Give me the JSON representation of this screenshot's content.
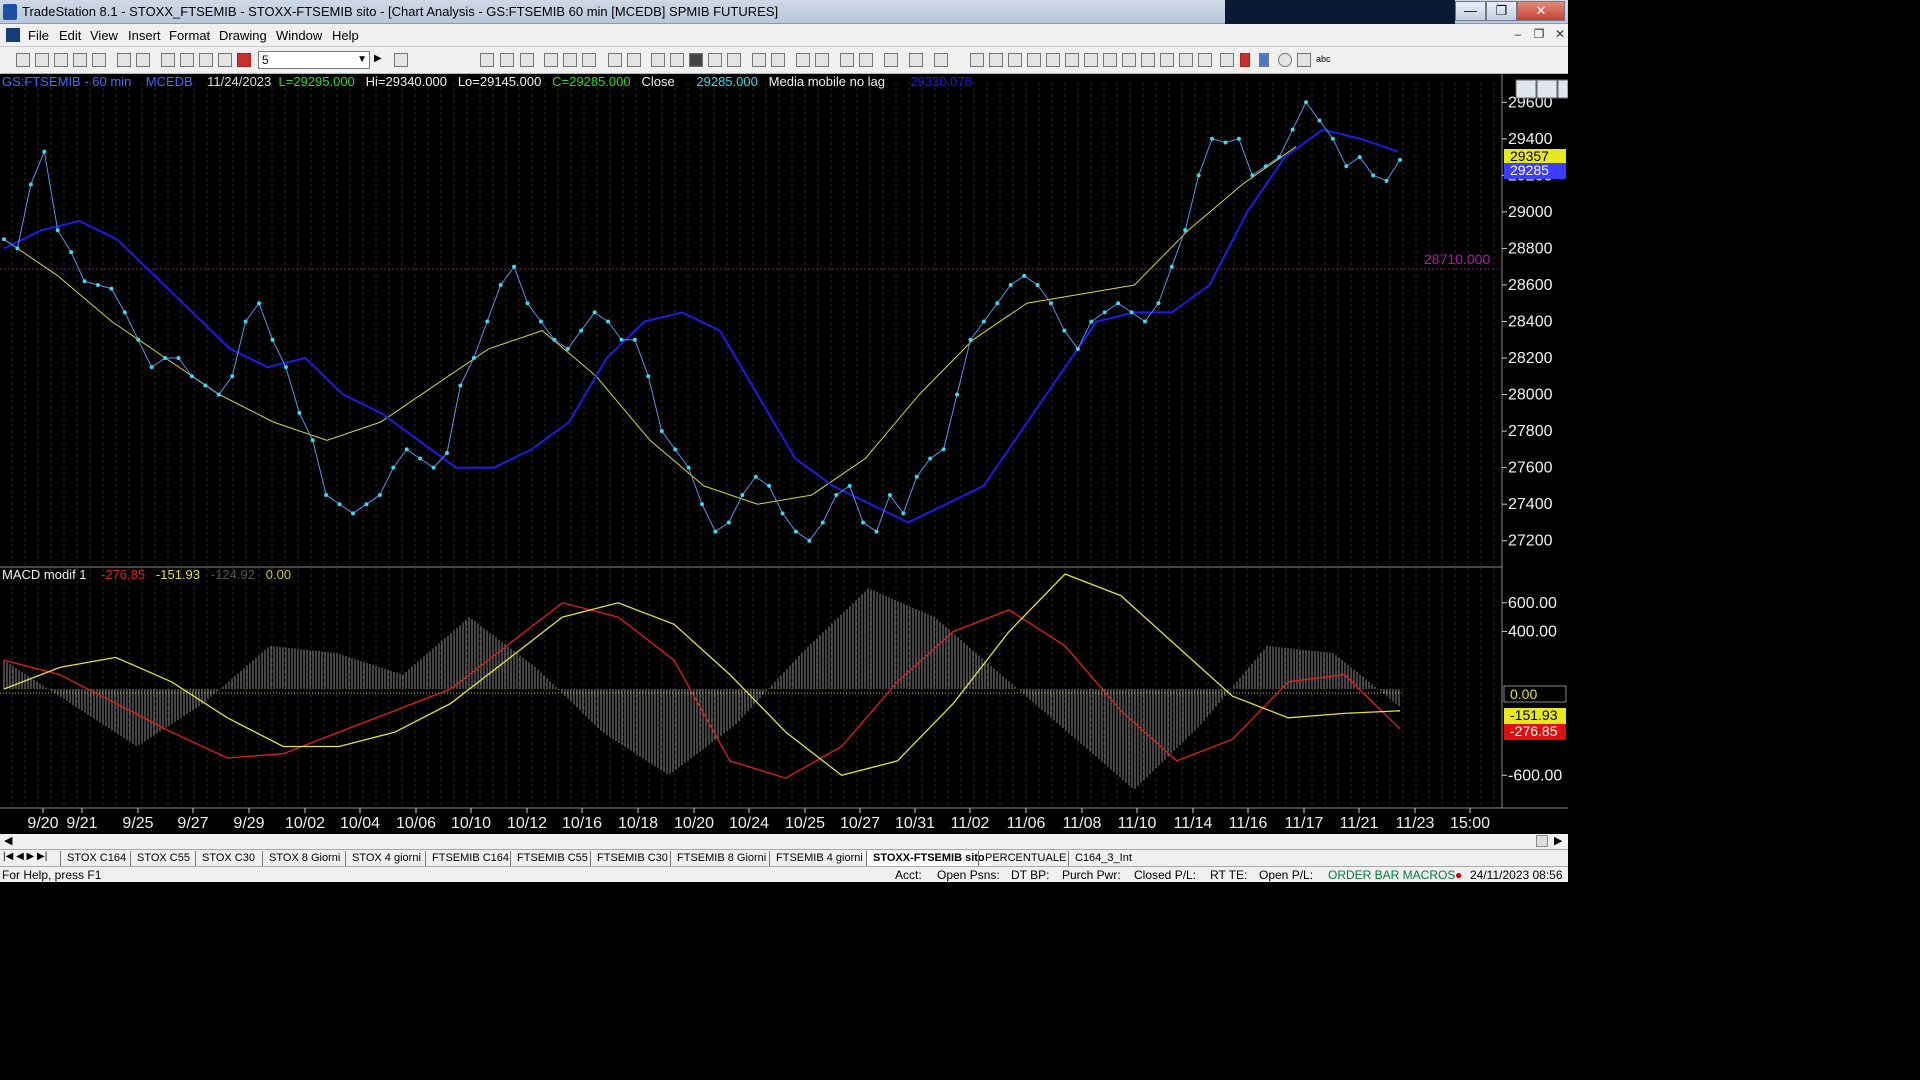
{
  "window": {
    "title": "TradeStation 8.1 - STOXX_FTSEMIB - STOXX-FTSEMIB sito - [Chart Analysis - GS:FTSEMIB  60 min  [MCEDB] SPMIB FUTURES]",
    "minimize": "—",
    "restore": "❐",
    "close": "✕"
  },
  "menu": [
    "File",
    "Edit",
    "View",
    "Insert",
    "Format",
    "Drawing",
    "Window",
    "Help"
  ],
  "toolbar": {
    "interval_value": "5"
  },
  "chart": {
    "header": {
      "symbol": "GS:FTSEMIB - 60 min",
      "datafeed": "MCEDB",
      "date": "11/24/2023",
      "last": "L=29295.000",
      "high": "Hi=29340.000",
      "low": "Lo=29145.000",
      "close": "C=29285.000",
      "close_label": "Close",
      "close_value": "29285.000",
      "indicator": "Media mobile no lag",
      "indicator_value": "29330.078"
    },
    "price_line_label": "28710.000",
    "macd_header": {
      "name": "MACD modif 1",
      "v1": "-276.85",
      "v2": "-151.93",
      "v3": "-124.92",
      "v4": "0.00"
    },
    "price_axis_ticks": [
      "29600",
      "29400",
      "29200",
      "29000",
      "28800",
      "28600",
      "28400",
      "28200",
      "28000",
      "27800",
      "27600",
      "27400",
      "27200"
    ],
    "price_badges": {
      "yellow": "29357",
      "blue": "29285"
    },
    "macd_axis_ticks": [
      "600.00",
      "400.00",
      "-600.00"
    ],
    "macd_badges": {
      "zero": "0.00",
      "signal": "-151.93",
      "macd": "-276.85"
    },
    "date_axis": [
      "9/20",
      "9/21",
      "9/25",
      "9/27",
      "9/29",
      "10/02",
      "10/04",
      "10/06",
      "10/10",
      "10/12",
      "10/16",
      "10/18",
      "10/20",
      "10/24",
      "10/25",
      "10/27",
      "10/31",
      "11/02",
      "11/06",
      "11/08",
      "11/10",
      "11/14",
      "11/16",
      "11/17",
      "11/21",
      "11/23",
      "15:00"
    ]
  },
  "chart_data": [
    {
      "type": "line",
      "title": "GS:FTSEMIB - 60 min",
      "ylim": [
        27100,
        29700
      ],
      "series": [
        {
          "name": "Close",
          "color": "#3fd8ea",
          "values": [
            28850,
            28800,
            29150,
            29330,
            28900,
            28780,
            28620,
            28600,
            28580,
            28450,
            28300,
            28150,
            28200,
            28200,
            28100,
            28050,
            28000,
            28100,
            28400,
            28500,
            28300,
            28150,
            27900,
            27750,
            27450,
            27400,
            27350,
            27400,
            27450,
            27600,
            27700,
            27650,
            27600,
            27680,
            28050,
            28200,
            28400,
            28600,
            28700,
            28500,
            28400,
            28300,
            28250,
            28350,
            28450,
            28400,
            28300,
            28300,
            28100,
            27800,
            27700,
            27600,
            27400,
            27250,
            27300,
            27450,
            27550,
            27500,
            27350,
            27250,
            27200,
            27300,
            27450,
            27500,
            27300,
            27250,
            27450,
            27350,
            27550,
            27650,
            27700,
            28000,
            28300,
            28400,
            28500,
            28600,
            28650,
            28600,
            28500,
            28350,
            28250,
            28400,
            28450,
            28500,
            28450,
            28400,
            28500,
            28700,
            28900,
            29200,
            29400,
            29380,
            29400,
            29200,
            29250,
            29300,
            29450,
            29600,
            29500,
            29400,
            29250,
            29300,
            29200,
            29170,
            29285
          ]
        },
        {
          "name": "Media mobile no lag",
          "color": "#1c1ce6",
          "values": [
            28800,
            28900,
            28950,
            28850,
            28650,
            28450,
            28250,
            28150,
            28200,
            28000,
            27900,
            27750,
            27600,
            27600,
            27700,
            27850,
            28200,
            28400,
            28450,
            28350,
            28000,
            27650,
            27500,
            27400,
            27300,
            27400,
            27500,
            27800,
            28100,
            28400,
            28450,
            28450,
            28600,
            29000,
            29300,
            29450,
            29400,
            29330
          ]
        },
        {
          "name": "",
          "color": "#d6d63a",
          "values": [
            28850,
            28650,
            28400,
            28200,
            28000,
            27850,
            27750,
            27850,
            28050,
            28250,
            28350,
            28100,
            27750,
            27500,
            27400,
            27450,
            27650,
            28000,
            28300,
            28500,
            28550,
            28600,
            28900,
            29150,
            29357
          ]
        }
      ]
    },
    {
      "type": "line",
      "title": "MACD modif 1",
      "ylim": [
        -800,
        800
      ],
      "series": [
        {
          "name": "",
          "color": "#e02020",
          "values": [
            200,
            100,
            -100,
            -300,
            -480,
            -450,
            -300,
            -150,
            0,
            300,
            600,
            500,
            200,
            -500,
            -620,
            -400,
            50,
            400,
            550,
            300,
            -150,
            -500,
            -350,
            50,
            100,
            -276.85
          ]
        },
        {
          "name": "",
          "color": "#e2e23a",
          "values": [
            0,
            150,
            220,
            50,
            -200,
            -400,
            -400,
            -300,
            -100,
            200,
            500,
            600,
            450,
            100,
            -300,
            -600,
            -500,
            -100,
            400,
            800,
            650,
            300,
            -50,
            -200,
            -170,
            -151.93
          ]
        },
        {
          "name": "",
          "color": "#9a9a9a",
          "values": [
            200,
            -100,
            -400,
            -100,
            300,
            250,
            100,
            500,
            150,
            -300,
            -600,
            -250,
            250,
            700,
            500,
            100,
            -300,
            -700,
            -250,
            300,
            250,
            -124.92
          ]
        }
      ]
    }
  ],
  "tabs": [
    "STOX C164",
    "STOX C55",
    "STOX  C30",
    "STOX  8 Giorni",
    "STOX 4 giorni",
    "FTSEMIB C164",
    "FTSEMIB C55",
    "FTSEMIB C30",
    "FTSEMIB  8 Giorni",
    "FTSEMIB  4 giorni",
    "STOXX-FTSEMIB sito",
    "PERCENTUALE",
    "C164_3_Int"
  ],
  "status": {
    "help": "For Help, press F1",
    "acct": "Acct:",
    "open_psns": "Open Psns:",
    "dt_bp": "DT BP:",
    "purch_pwr": "Purch Pwr:",
    "closed_pl": "Closed P/L:",
    "rt_te": "RT TE:",
    "open_pl": "Open P/L:",
    "macros": "ORDER BAR  MACROS",
    "datetime": "24/11/2023 08:56"
  }
}
